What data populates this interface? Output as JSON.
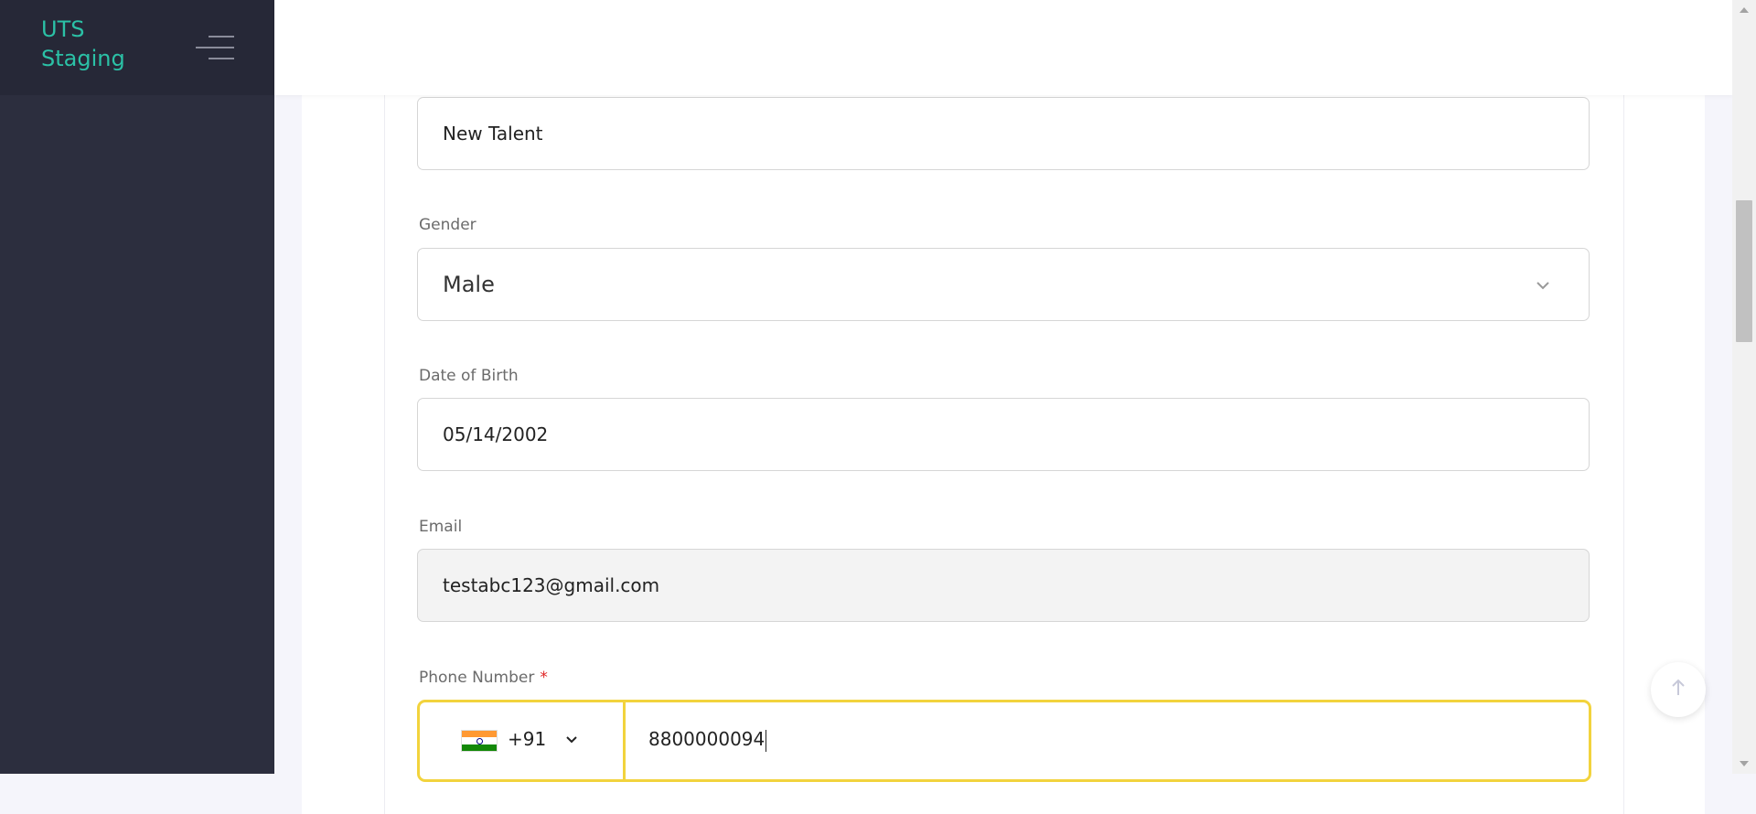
{
  "app": {
    "brand_line1": "UTS",
    "brand_line2": "Staging"
  },
  "form": {
    "name_value": "New Talent",
    "gender": {
      "label": "Gender",
      "value": "Male"
    },
    "dob": {
      "label": "Date of Birth",
      "value": "05/14/2002"
    },
    "email": {
      "label": "Email",
      "value": "testabc123@gmail.com"
    },
    "phone": {
      "label": "Phone Number",
      "required_mark": "*",
      "country_code": "+91",
      "value": "8800000094"
    }
  },
  "icons": {
    "menu": "hamburger-icon",
    "dropdown": "chevron-down-icon",
    "flag": "india-flag-icon",
    "scroll_top": "arrow-up-icon"
  },
  "colors": {
    "sidebar": "#2c2e3e",
    "brand": "#2bc1a6",
    "focus_border": "#f2d33d",
    "required": "#e02424"
  }
}
